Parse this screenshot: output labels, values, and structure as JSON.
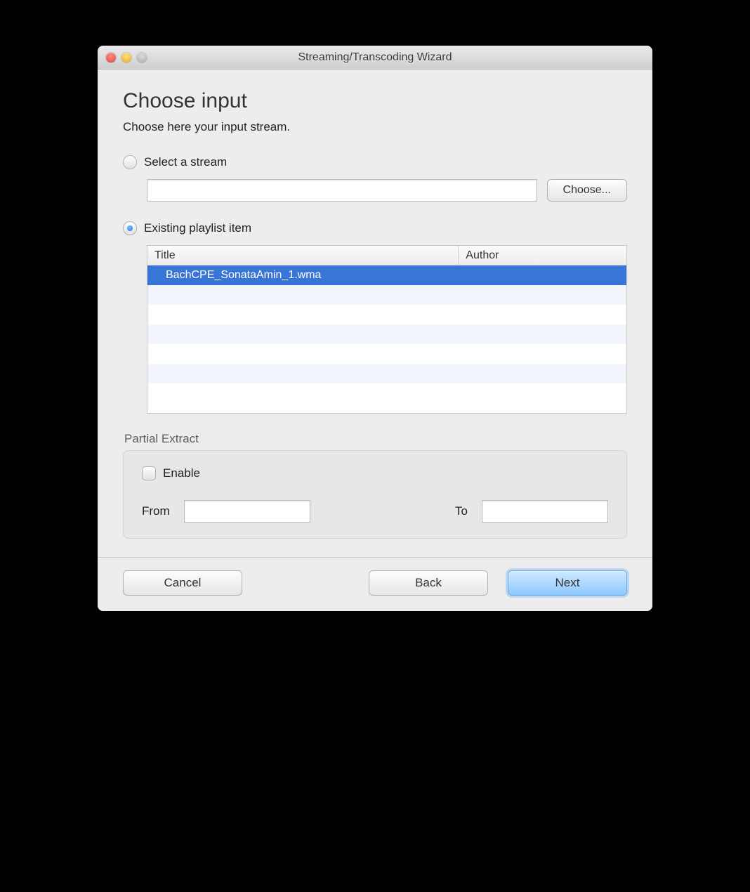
{
  "window": {
    "title": "Streaming/Transcoding Wizard"
  },
  "page": {
    "heading": "Choose input",
    "subtext": "Choose here your input stream."
  },
  "options": {
    "select_stream": {
      "label": "Select a stream",
      "selected": false,
      "input_value": "",
      "choose_button": "Choose..."
    },
    "existing_playlist": {
      "label": "Existing playlist item",
      "selected": true
    }
  },
  "table": {
    "columns": {
      "title": "Title",
      "author": "Author"
    },
    "rows": [
      {
        "title": "BachCPE_SonataAmin_1.wma",
        "author": "",
        "selected": true
      }
    ]
  },
  "partial_extract": {
    "group_label": "Partial Extract",
    "enable_label": "Enable",
    "enable_checked": false,
    "from_label": "From",
    "from_value": "",
    "to_label": "To",
    "to_value": ""
  },
  "footer": {
    "cancel": "Cancel",
    "back": "Back",
    "next": "Next"
  }
}
